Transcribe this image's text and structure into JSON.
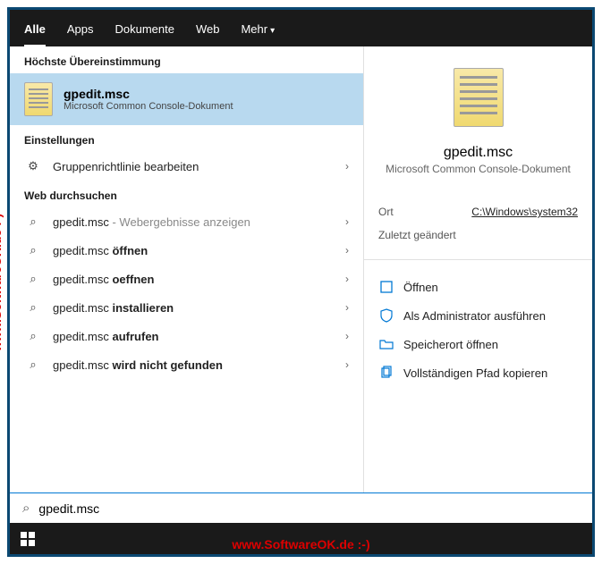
{
  "tabs": {
    "all": "Alle",
    "apps": "Apps",
    "documents": "Dokumente",
    "web": "Web",
    "more": "Mehr"
  },
  "sections": {
    "best_match": "Höchste Übereinstimmung",
    "settings": "Einstellungen",
    "search_web": "Web durchsuchen"
  },
  "best_match": {
    "title": "gpedit.msc",
    "subtitle": "Microsoft Common Console-Dokument"
  },
  "settings_items": [
    {
      "text": "Gruppenrichtlinie bearbeiten"
    }
  ],
  "web_items": [
    {
      "prefix": "gpedit.msc",
      "bold": "",
      "hint": " - Webergebnisse anzeigen"
    },
    {
      "prefix": "gpedit.msc ",
      "bold": "öffnen",
      "hint": ""
    },
    {
      "prefix": "gpedit.msc ",
      "bold": "oeffnen",
      "hint": ""
    },
    {
      "prefix": "gpedit.msc ",
      "bold": "installieren",
      "hint": ""
    },
    {
      "prefix": "gpedit.msc ",
      "bold": "aufrufen",
      "hint": ""
    },
    {
      "prefix": "gpedit.msc ",
      "bold": "wird nicht gefunden",
      "hint": ""
    }
  ],
  "detail": {
    "filename": "gpedit.msc",
    "subtitle": "Microsoft Common Console-Dokument",
    "meta": {
      "location_label": "Ort",
      "location_value": "C:\\Windows\\system32",
      "modified_label": "Zuletzt geändert"
    },
    "actions": {
      "open": "Öffnen",
      "run_admin": "Als Administrator ausführen",
      "open_location": "Speicherort öffnen",
      "copy_path": "Vollständigen Pfad kopieren"
    }
  },
  "search_input": "gpedit.msc",
  "watermark": "www.SoftwareOK.de  :-)"
}
